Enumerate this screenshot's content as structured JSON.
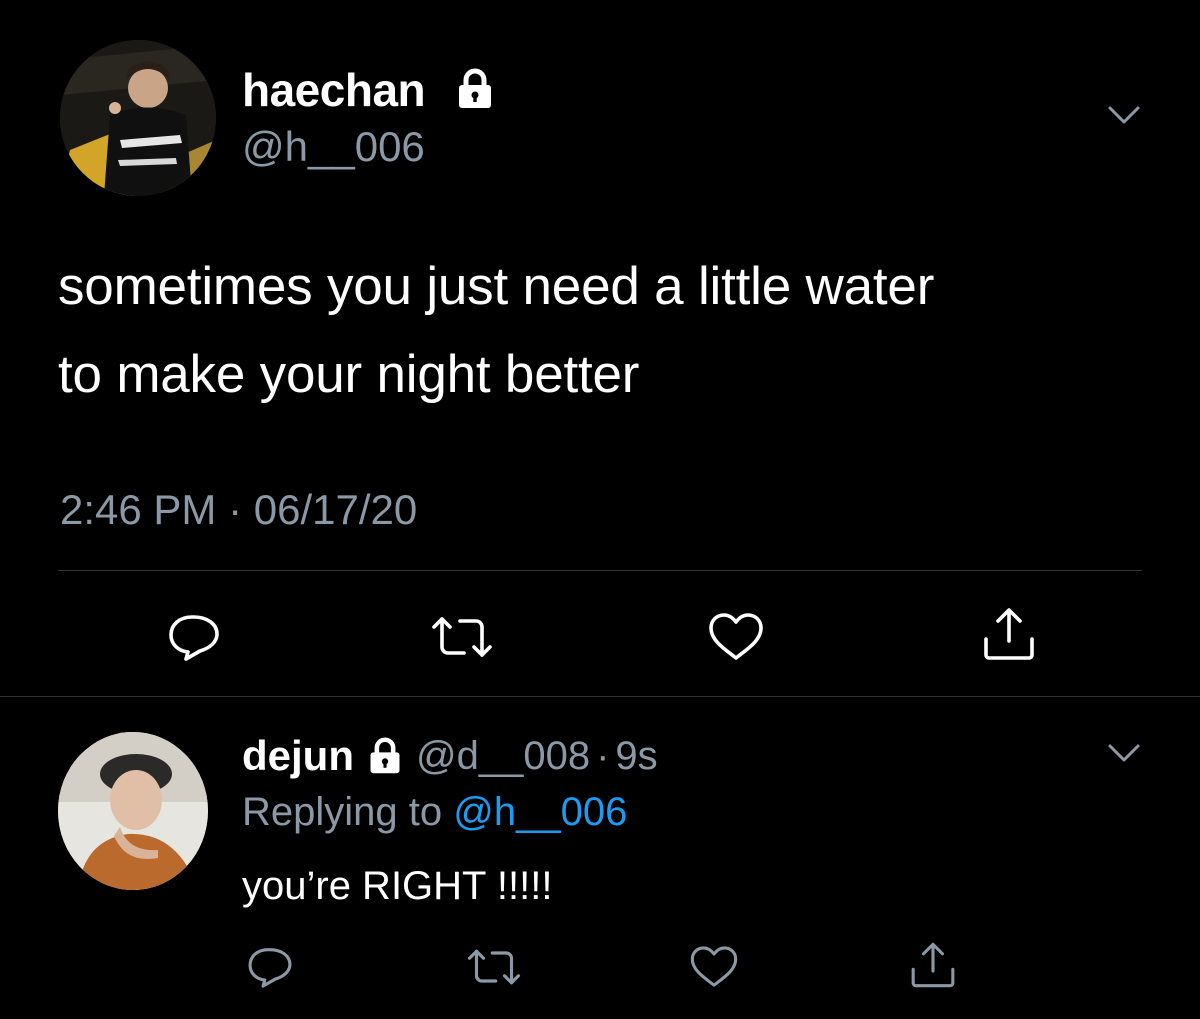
{
  "tweet": {
    "author": {
      "display_name": "haechan",
      "handle": "@h__006",
      "protected_icon": "lock-icon"
    },
    "text_lines": [
      "sometimes you just need a little water",
      "to make your night better"
    ],
    "timestamp": "2:46 PM · 06/17/20",
    "actions": [
      "reply-icon",
      "retweet-icon",
      "like-icon",
      "share-icon"
    ]
  },
  "reply": {
    "author": {
      "display_name": "dejun",
      "handle": "@d__008",
      "protected_icon": "lock-icon"
    },
    "time": "9s",
    "separator": "·",
    "replying_prefix": "Replying to",
    "replying_mention": "@h__006",
    "text": "you’re RIGHT !!!!!",
    "actions": [
      "reply-icon",
      "retweet-icon",
      "like-icon",
      "share-icon"
    ]
  },
  "colors": {
    "background": "#000000",
    "text": "#ffffff",
    "secondary_text": "#8b98a5",
    "mention": "#1d9bf0",
    "divider": "#2f3336",
    "icon": "#8b98a5"
  }
}
